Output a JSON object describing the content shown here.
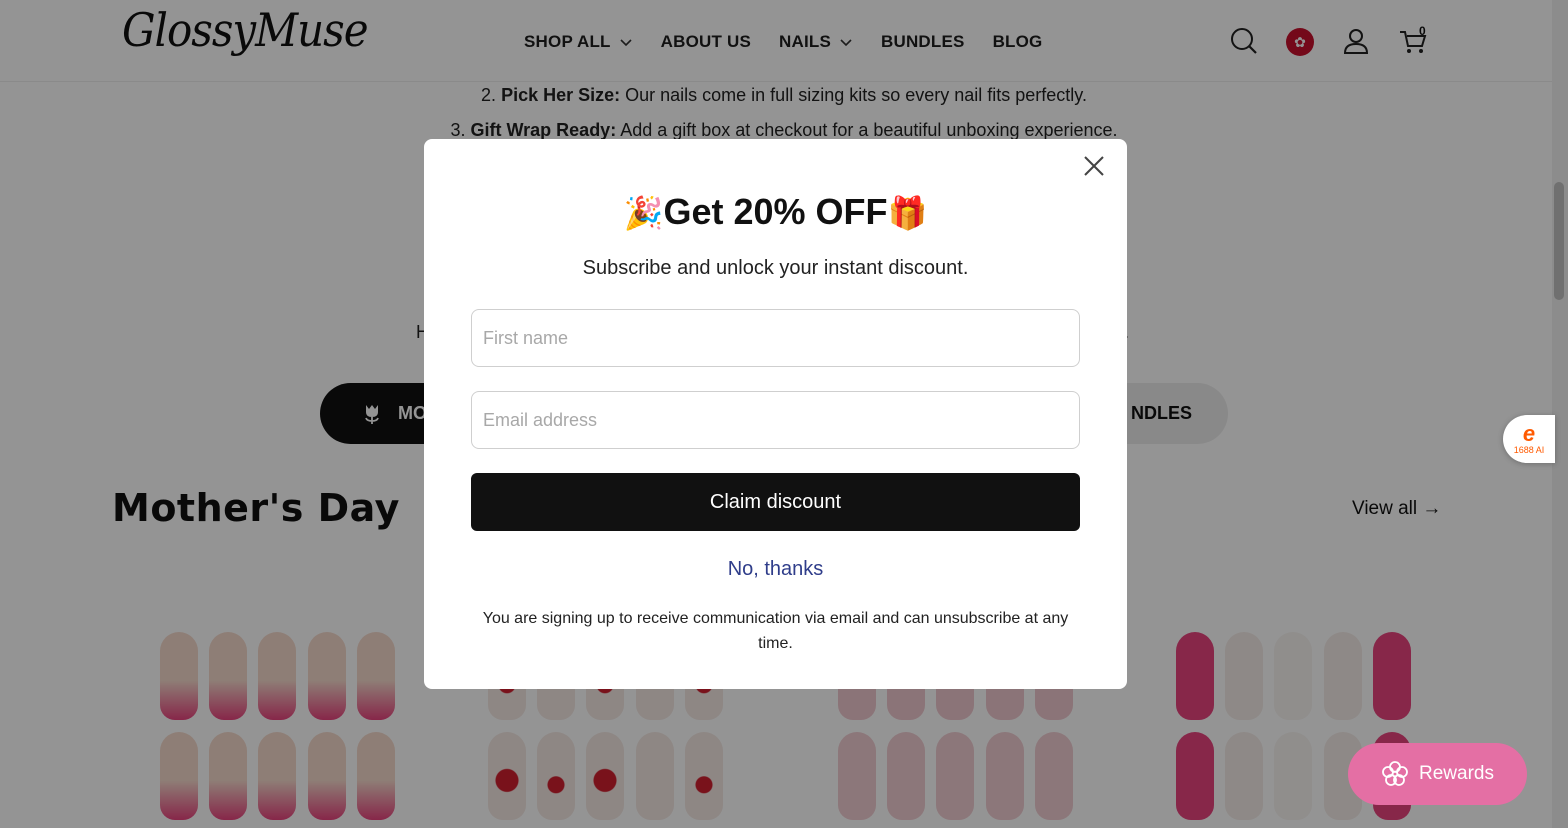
{
  "header": {
    "logo": "GlossyMuse",
    "nav": [
      {
        "label": "SHOP ALL",
        "dropdown": true
      },
      {
        "label": "ABOUT US",
        "dropdown": false
      },
      {
        "label": "NAILS",
        "dropdown": true
      },
      {
        "label": "BUNDLES",
        "dropdown": false
      },
      {
        "label": "BLOG",
        "dropdown": false
      }
    ],
    "icons": [
      "search-icon",
      "hong-kong-flag-icon",
      "account-icon",
      "cart-icon"
    ],
    "cart_count": "0"
  },
  "content": {
    "step2_num": "2.",
    "step2_bold": "Pick Her Size:",
    "step2_text": " Our nails come in full sizing kits so every nail fits perfectly.",
    "step3_num": "3.",
    "step3_bold": "Gift Wrap Ready:",
    "step3_text": " Add a gift box at checkout for a beautiful unboxing experience.",
    "stray_left": "H",
    "stray_right": ".",
    "pill_dark_label": "MO",
    "pill_light_label": "NDLES",
    "section_title": "Mother's Day",
    "view_all": "View all →"
  },
  "side": {
    "badge_mark": "e",
    "badge_text": "1688 AI",
    "rewards_label": "Rewards"
  },
  "popup": {
    "title_emoji_left": "🎉",
    "title": "Get 20% OFF",
    "title_emoji_right": "🎁",
    "subtitle": "Subscribe and unlock your instant discount.",
    "first_name_placeholder": "First name",
    "email_placeholder": "Email address",
    "claim_label": "Claim discount",
    "decline_label": "No, thanks",
    "legal": "You are signing up to receive communication via email and can unsubscribe at any time."
  },
  "colors": {
    "accent_dark": "#111111",
    "link_blue": "#2f3d8a",
    "rewards_pink": "#e46fa4",
    "nail_pink": "#e8447e"
  }
}
